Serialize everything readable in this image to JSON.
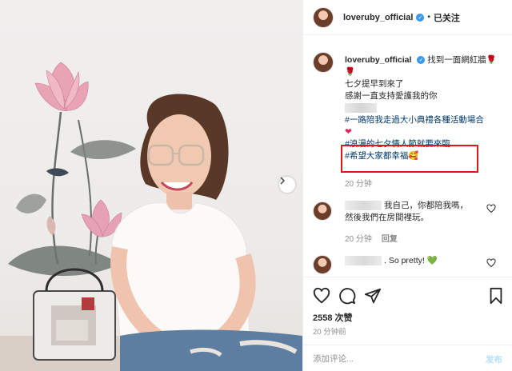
{
  "header": {
    "username": "loveruby_official",
    "separator": "•",
    "follow_status": "已关注"
  },
  "caption": {
    "username": "loveruby_official",
    "line1": "找到一面網紅牆🌹",
    "line2": "🌹",
    "line3": "七夕提早到來了",
    "line4": "感謝一直支持愛護我的你",
    "tag1": "#一路陪我走過大小典禮各種活動場合",
    "heart": "❤",
    "tag2": "#浪漫的七夕情人節就要來臨",
    "tag3": "#希望大家都幸福🥰",
    "time": "20 分钟"
  },
  "comments": [
    {
      "text_line1": "我自己，你都陪我嗎，",
      "text_line2": "然後我們在房間裡玩。",
      "time": "20 分钟",
      "reply": "回复"
    },
    {
      "text": ". So pretty! ",
      "emoji": "💚"
    }
  ],
  "actions": {
    "likes": "2558 次赞",
    "time": "20 分钟前",
    "add_placeholder": "添加评论...",
    "post_label": "发布"
  },
  "colors": {
    "hashtag": "#00376b",
    "highlight_box": "#e0161c",
    "verified": "#3897f0",
    "post_disabled": "#b2dffc"
  },
  "icons": [
    "chevron-right-icon",
    "verified-icon",
    "heart-icon",
    "comment-icon",
    "share-icon",
    "bookmark-icon"
  ]
}
